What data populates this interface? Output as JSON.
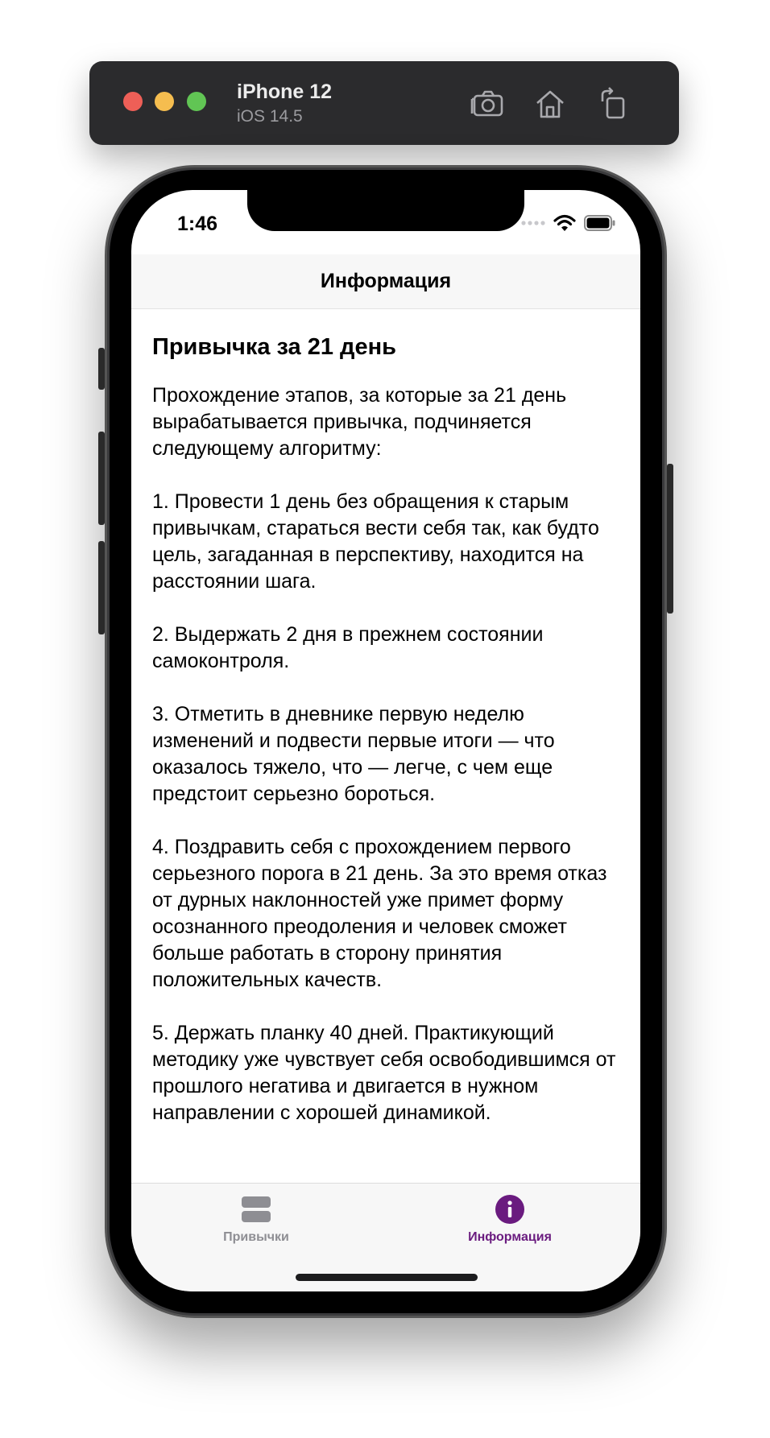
{
  "simulator": {
    "device_name": "iPhone 12",
    "os_version": "iOS 14.5",
    "icons": [
      "screenshot-icon",
      "home-icon",
      "rotate-icon"
    ]
  },
  "status_bar": {
    "time": "1:46"
  },
  "nav": {
    "title": "Информация"
  },
  "content": {
    "heading": "Привычка за 21 день",
    "body": "Прохождение этапов, за которые за 21 день вырабатывается привычка, подчиняется следующему алгоритму:\n\n1. Провести 1 день без обращения к старым привычкам, стараться вести себя так, как будто цель, загаданная в перспективу, находится на расстоянии шага.\n\n2. Выдержать 2 дня в прежнем состоянии самоконтроля.\n\n3. Отметить в дневнике первую неделю изменений и подвести первые итоги — что оказалось тяжело, что — легче, с чем еще предстоит серьезно бороться.\n\n4. Поздравить себя с прохождением первого серьезного порога в 21 день. За это время отказ от дурных наклонностей уже примет форму осознанного преодоления и человек сможет больше работать в сторону принятия положительных качеств.\n\n5. Держать планку 40 дней. Практикующий методику уже чувствует себя освободившимся от прошлого негатива и двигается в нужном направлении с хорошей динамикой."
  },
  "tabs": [
    {
      "label": "Привычки",
      "icon": "rectangle-stack-icon",
      "selected": false
    },
    {
      "label": "Информация",
      "icon": "info-circle-icon",
      "selected": true
    }
  ],
  "colors": {
    "accent": "#6a1b7f",
    "inactive": "#8e8e93"
  }
}
